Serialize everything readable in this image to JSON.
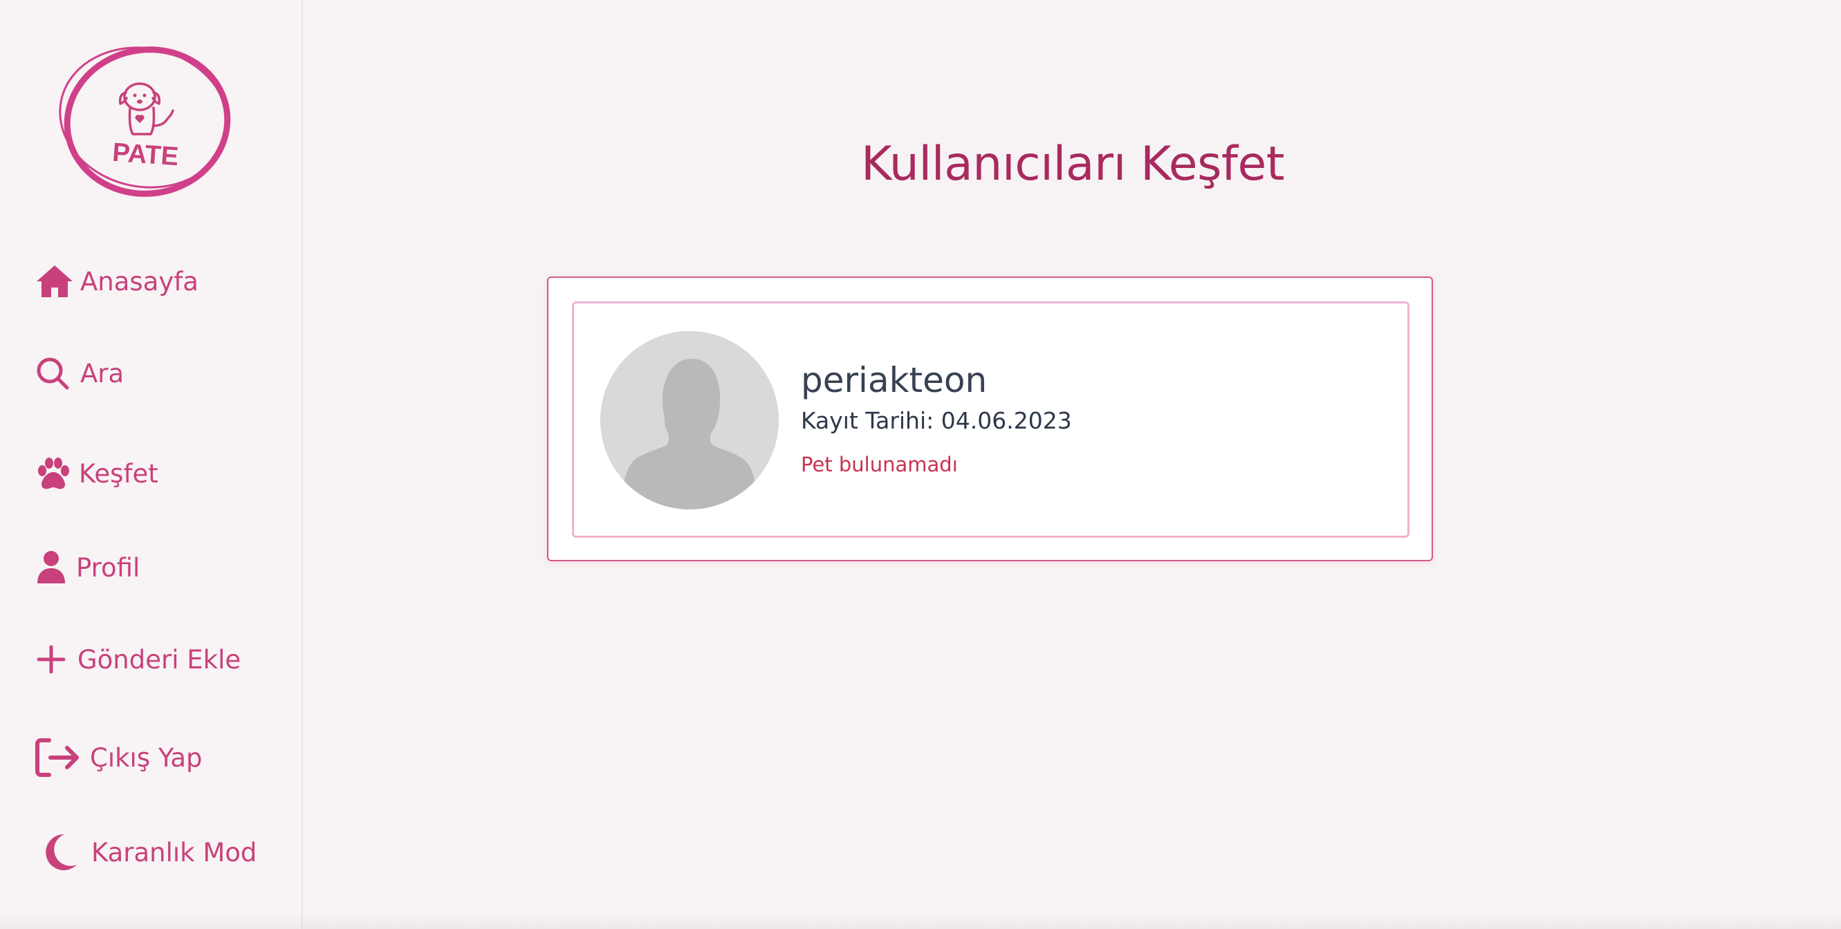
{
  "brand": {
    "logo_text": "PATE",
    "accent": "#c8417d",
    "title_color": "#a82a5e"
  },
  "sidebar": {
    "items": [
      {
        "label": "Anasayfa",
        "icon": "home-icon"
      },
      {
        "label": "Ara",
        "icon": "search-icon"
      },
      {
        "label": "Keşfet",
        "icon": "paw-icon"
      },
      {
        "label": "Profil",
        "icon": "user-icon"
      },
      {
        "label": "Gönderi Ekle",
        "icon": "plus-icon"
      },
      {
        "label": "Çıkış Yap",
        "icon": "logout-icon"
      },
      {
        "label": "Karanlık Mod",
        "icon": "moon-icon"
      }
    ]
  },
  "main": {
    "title": "Kullanıcıları Keşfet",
    "users": [
      {
        "username": "periakteon",
        "registration": "Kayıt Tarihi: 04.06.2023",
        "pets_status": "Pet bulunamadı"
      }
    ]
  }
}
